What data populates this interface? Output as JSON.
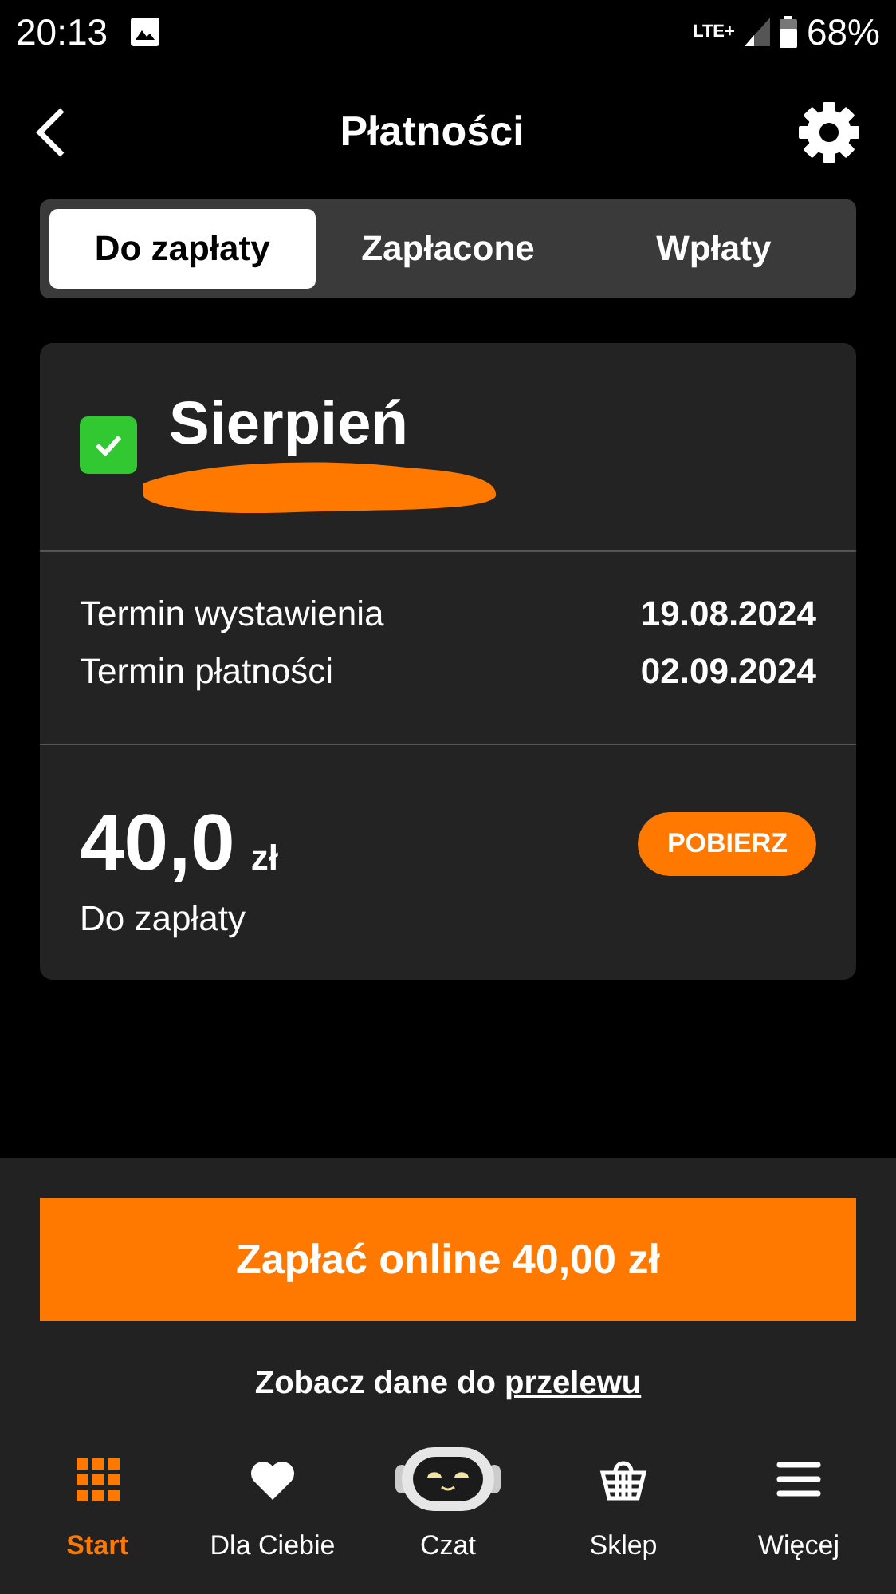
{
  "status_bar": {
    "time": "20:13",
    "network": "LTE+",
    "battery": "68%"
  },
  "header": {
    "title": "Płatności"
  },
  "tabs": [
    {
      "label": "Do zapłaty",
      "selected": true
    },
    {
      "label": "Zapłacone",
      "selected": false
    },
    {
      "label": "Wpłaty",
      "selected": false
    }
  ],
  "invoice": {
    "title": "Sierpień",
    "paid_check": true,
    "redacted": true,
    "details": [
      {
        "label": "Termin wystawienia",
        "value": "19.08.2024"
      },
      {
        "label": "Termin płatności",
        "value": "02.09.2024"
      }
    ],
    "amount": "40,0",
    "currency": "zł",
    "amount_caption": "Do zapłaty",
    "action": "POBIERZ"
  },
  "pay_button": "Zapłać online 40,00 zł",
  "transfer_link": {
    "text": "Zobacz dane do ",
    "link": "przelewu"
  },
  "nav": [
    {
      "label": "Start",
      "kind": "grid",
      "selected": true
    },
    {
      "label": "Dla Ciebie",
      "kind": "heart",
      "selected": false
    },
    {
      "label": "Czat",
      "kind": "bot",
      "selected": false
    },
    {
      "label": "Sklep",
      "kind": "basket",
      "selected": false
    },
    {
      "label": "Więcej",
      "kind": "menu",
      "selected": false
    }
  ]
}
